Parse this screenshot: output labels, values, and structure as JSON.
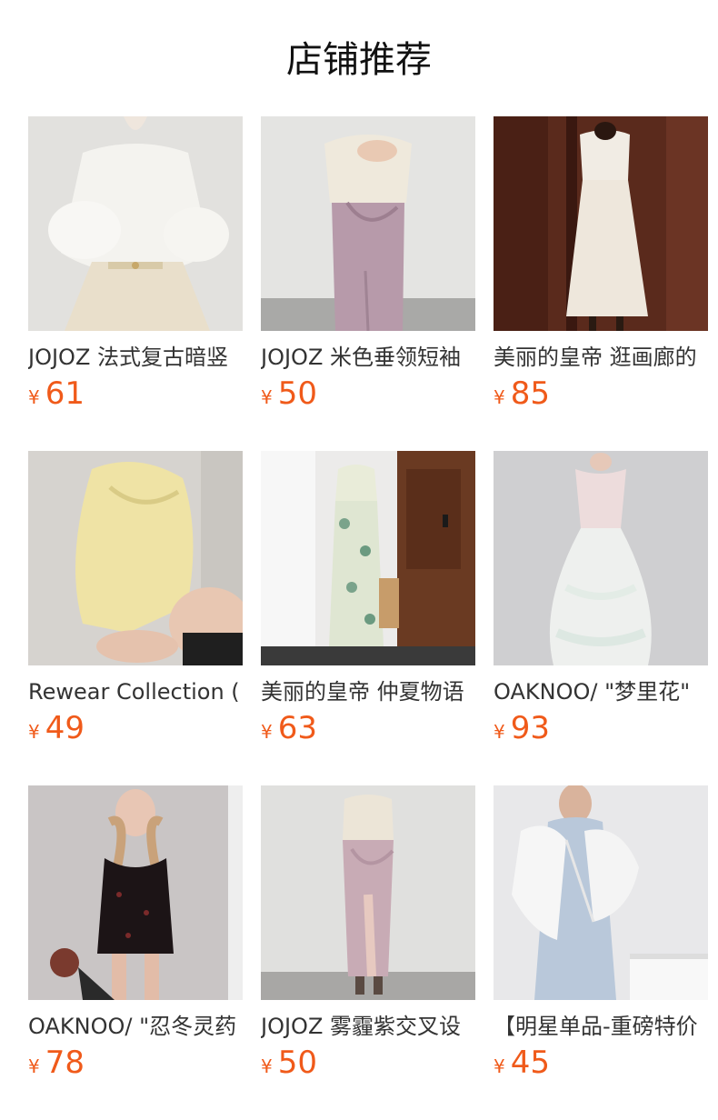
{
  "section": {
    "title": "店铺推荐"
  },
  "currency_symbol": "¥",
  "colors": {
    "price": "#f05a1a",
    "title": "#111111",
    "name": "#333333"
  },
  "products": [
    {
      "name": "JOJOZ 法式复古暗竖",
      "price": "61",
      "image": "white-puff-sleeve-blouse"
    },
    {
      "name": "JOJOZ 米色垂领短袖",
      "price": "50",
      "image": "cream-top-lilac-wrap-skirt"
    },
    {
      "name": "美丽的皇帝 逛画廊的",
      "price": "85",
      "image": "white-ruffle-maxi-dress"
    },
    {
      "name": "Rewear Collection (",
      "price": "49",
      "image": "yellow-cowl-neck-top"
    },
    {
      "name": "美丽的皇帝 仲夏物语",
      "price": "63",
      "image": "green-floral-midi-dress"
    },
    {
      "name": "OAKNOO/ \"梦里花\"",
      "price": "93",
      "image": "pink-tulle-slip-dress"
    },
    {
      "name": "OAKNOO/ \"忍冬灵药",
      "price": "78",
      "image": "black-floral-mini-dress"
    },
    {
      "name": "JOJOZ 雾霾紫交叉设",
      "price": "50",
      "image": "lilac-slit-wrap-skirt"
    },
    {
      "name": "【明星单品-重磅特价",
      "price": "45",
      "image": "blue-slip-dress-white-cardigan"
    }
  ]
}
